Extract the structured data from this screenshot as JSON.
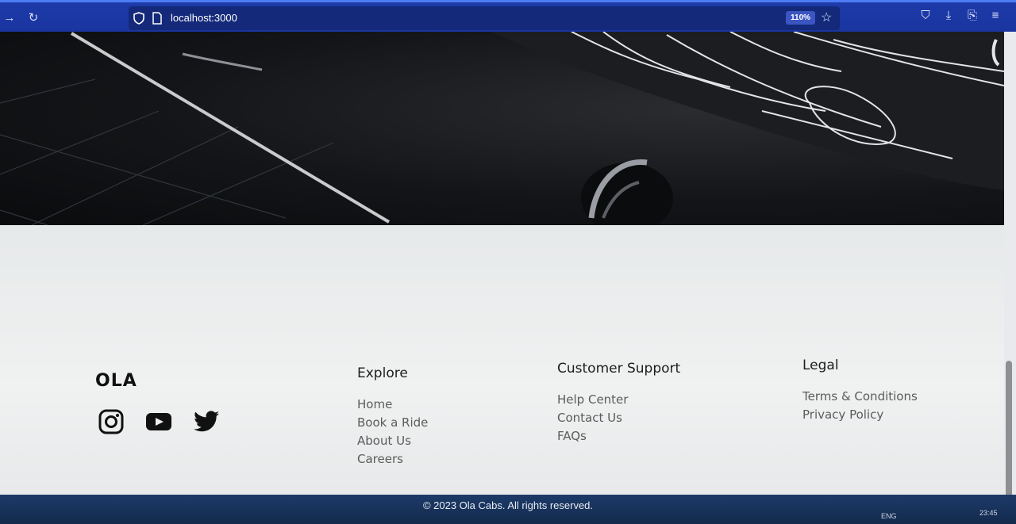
{
  "browser": {
    "url": "localhost:3000",
    "zoom": "110%"
  },
  "footer": {
    "brand": "OLA",
    "socials": [
      "instagram-icon",
      "youtube-icon",
      "twitter-icon"
    ],
    "columns": [
      {
        "title": "Explore",
        "links": [
          "Home",
          "Book a Ride",
          "About Us",
          "Careers"
        ]
      },
      {
        "title": "Customer Support",
        "links": [
          "Help Center",
          "Contact Us",
          "FAQs"
        ]
      },
      {
        "title": "Legal",
        "links": [
          "Terms & Conditions",
          "Privacy Policy"
        ]
      }
    ],
    "copyright": "© 2023 Ola Cabs. All rights reserved."
  },
  "taskbar": {
    "lang": "ENG",
    "time": "23:45"
  },
  "colors": {
    "toolbar": "#1d3aa8",
    "footer_bg": "#eceeef",
    "bottom_bar": "#1c3a68"
  }
}
